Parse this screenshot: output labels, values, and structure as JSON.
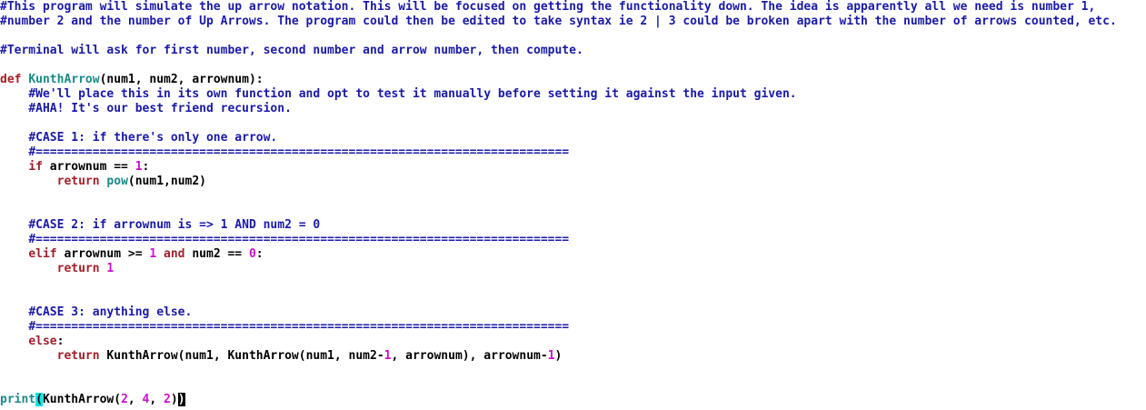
{
  "editor": {
    "colors": {
      "background": "#ffffff",
      "comment": "#1a1aa6",
      "keyword": "#a0212a",
      "function": "#1a8a8a",
      "number": "#cc11cc",
      "text": "#000000",
      "cursor": "#00e6e6"
    },
    "lines": [
      {
        "row": 0,
        "tokens": [
          {
            "t": "comment",
            "v": "#This program will simulate the up arrow notation. This will be focused on getting the functionality down. The idea is apparently all we need is number 1,"
          }
        ]
      },
      {
        "row": 1,
        "tokens": [
          {
            "t": "comment",
            "v": "#number 2 and the number of Up Arrows. The program could then be edited to take syntax ie 2 | 3 could be broken apart with the number of arrows counted, etc."
          }
        ]
      },
      {
        "row": 3,
        "tokens": [
          {
            "t": "comment",
            "v": "#Terminal will ask for first number, second number and arrow number, then compute."
          }
        ]
      },
      {
        "row": 5,
        "tokens": [
          {
            "t": "keyword",
            "v": "def"
          },
          {
            "t": "text",
            "v": " "
          },
          {
            "t": "funcname",
            "v": "KunthArrow"
          },
          {
            "t": "text",
            "v": "(num1, num2, arrownum):"
          }
        ]
      },
      {
        "row": 6,
        "tokens": [
          {
            "t": "text",
            "v": "    "
          },
          {
            "t": "comment",
            "v": "#We'll place this in its own function and opt to test it manually before setting it against the input given."
          }
        ]
      },
      {
        "row": 7,
        "tokens": [
          {
            "t": "text",
            "v": "    "
          },
          {
            "t": "comment",
            "v": "#AHA! It's our best friend recursion."
          }
        ]
      },
      {
        "row": 9,
        "tokens": [
          {
            "t": "text",
            "v": "    "
          },
          {
            "t": "comment",
            "v": "#CASE 1: if there's only one arrow."
          }
        ]
      },
      {
        "row": 10,
        "tokens": [
          {
            "t": "text",
            "v": "    "
          },
          {
            "t": "comment",
            "v": "#==========================================================================="
          }
        ]
      },
      {
        "row": 11,
        "tokens": [
          {
            "t": "text",
            "v": "    "
          },
          {
            "t": "keyword",
            "v": "if"
          },
          {
            "t": "text",
            "v": " arrownum == "
          },
          {
            "t": "number",
            "v": "1"
          },
          {
            "t": "text",
            "v": ":"
          }
        ]
      },
      {
        "row": 12,
        "tokens": [
          {
            "t": "text",
            "v": "        "
          },
          {
            "t": "keyword",
            "v": "return"
          },
          {
            "t": "text",
            "v": " "
          },
          {
            "t": "builtin",
            "v": "pow"
          },
          {
            "t": "text",
            "v": "(num1,num2)"
          }
        ]
      },
      {
        "row": 15,
        "tokens": [
          {
            "t": "text",
            "v": "    "
          },
          {
            "t": "comment",
            "v": "#CASE 2: if arrownum is => 1 AND num2 = 0"
          }
        ]
      },
      {
        "row": 16,
        "tokens": [
          {
            "t": "text",
            "v": "    "
          },
          {
            "t": "comment",
            "v": "#==========================================================================="
          }
        ]
      },
      {
        "row": 17,
        "tokens": [
          {
            "t": "text",
            "v": "    "
          },
          {
            "t": "keyword",
            "v": "elif"
          },
          {
            "t": "text",
            "v": " arrownum >= "
          },
          {
            "t": "number",
            "v": "1"
          },
          {
            "t": "text",
            "v": " "
          },
          {
            "t": "keyword",
            "v": "and"
          },
          {
            "t": "text",
            "v": " num2 == "
          },
          {
            "t": "number",
            "v": "0"
          },
          {
            "t": "text",
            "v": ":"
          }
        ]
      },
      {
        "row": 18,
        "tokens": [
          {
            "t": "text",
            "v": "        "
          },
          {
            "t": "keyword",
            "v": "return"
          },
          {
            "t": "text",
            "v": " "
          },
          {
            "t": "number",
            "v": "1"
          }
        ]
      },
      {
        "row": 21,
        "tokens": [
          {
            "t": "text",
            "v": "    "
          },
          {
            "t": "comment",
            "v": "#CASE 3: anything else."
          }
        ]
      },
      {
        "row": 22,
        "tokens": [
          {
            "t": "text",
            "v": "    "
          },
          {
            "t": "comment",
            "v": "#==========================================================================="
          }
        ]
      },
      {
        "row": 23,
        "tokens": [
          {
            "t": "text",
            "v": "    "
          },
          {
            "t": "keyword",
            "v": "else"
          },
          {
            "t": "text",
            "v": ":"
          }
        ]
      },
      {
        "row": 24,
        "tokens": [
          {
            "t": "text",
            "v": "        "
          },
          {
            "t": "keyword",
            "v": "return"
          },
          {
            "t": "text",
            "v": " KunthArrow(num1, KunthArrow(num1, num2-"
          },
          {
            "t": "number",
            "v": "1"
          },
          {
            "t": "text",
            "v": ", arrownum), arrownum-"
          },
          {
            "t": "number",
            "v": "1"
          },
          {
            "t": "text",
            "v": ")"
          }
        ]
      },
      {
        "row": 27,
        "tokens": [
          {
            "t": "builtin",
            "v": "print"
          },
          {
            "t": "cursor",
            "v": "("
          },
          {
            "t": "text",
            "v": "KunthArrow("
          },
          {
            "t": "number",
            "v": "2"
          },
          {
            "t": "text",
            "v": ", "
          },
          {
            "t": "number",
            "v": "4"
          },
          {
            "t": "text",
            "v": ", "
          },
          {
            "t": "number",
            "v": "2"
          },
          {
            "t": "text",
            "v": ")"
          },
          {
            "t": "matchparen",
            "v": ")"
          }
        ]
      }
    ]
  }
}
